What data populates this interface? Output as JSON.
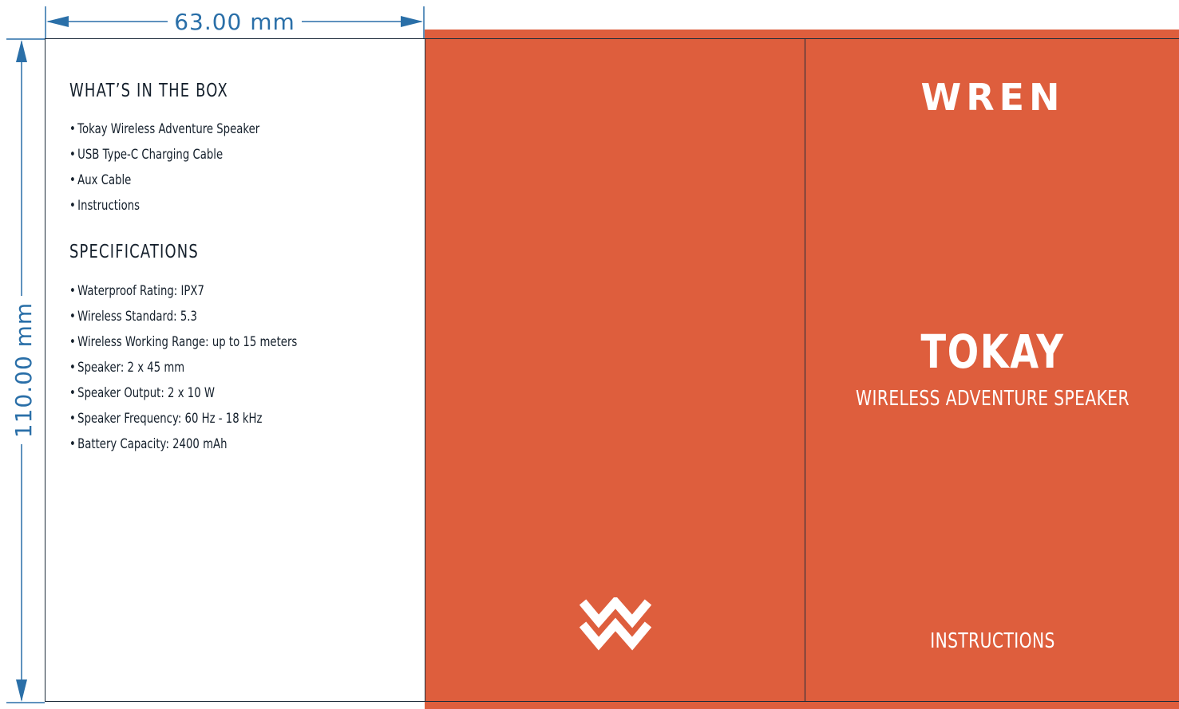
{
  "dimensions": {
    "width_label": "63.00 mm",
    "height_label": "110.00 mm",
    "line_color": "#2a6fa8"
  },
  "colors": {
    "brand_orange": "#de5e3d",
    "text_dark": "#15202c",
    "fold_line": "#1d2b3a"
  },
  "left_panel": {
    "box_heading": "WHAT’S IN THE BOX",
    "box_items": [
      "Tokay Wireless Adventure Speaker",
      "USB Type-C Charging Cable",
      "Aux Cable",
      "Instructions"
    ],
    "specs_heading": "SPECIFICATIONS",
    "spec_items": [
      "Waterproof Rating: IPX7",
      "Wireless Standard: 5.3",
      "Wireless Working Range: up to 15 meters",
      "Speaker: 2 x 45 mm",
      "Speaker Output: 2 x 10 W",
      "Speaker Frequency: 60 Hz - 18 kHz",
      "Battery Capacity: 2400 mAh"
    ]
  },
  "middle_panel": {
    "logo_icon": "wren-w-chevron-icon"
  },
  "right_panel": {
    "brand": "WREN",
    "product": "TOKAY",
    "subtitle": "WIRELESS ADVENTURE SPEAKER",
    "footer": "INSTRUCTIONS"
  }
}
